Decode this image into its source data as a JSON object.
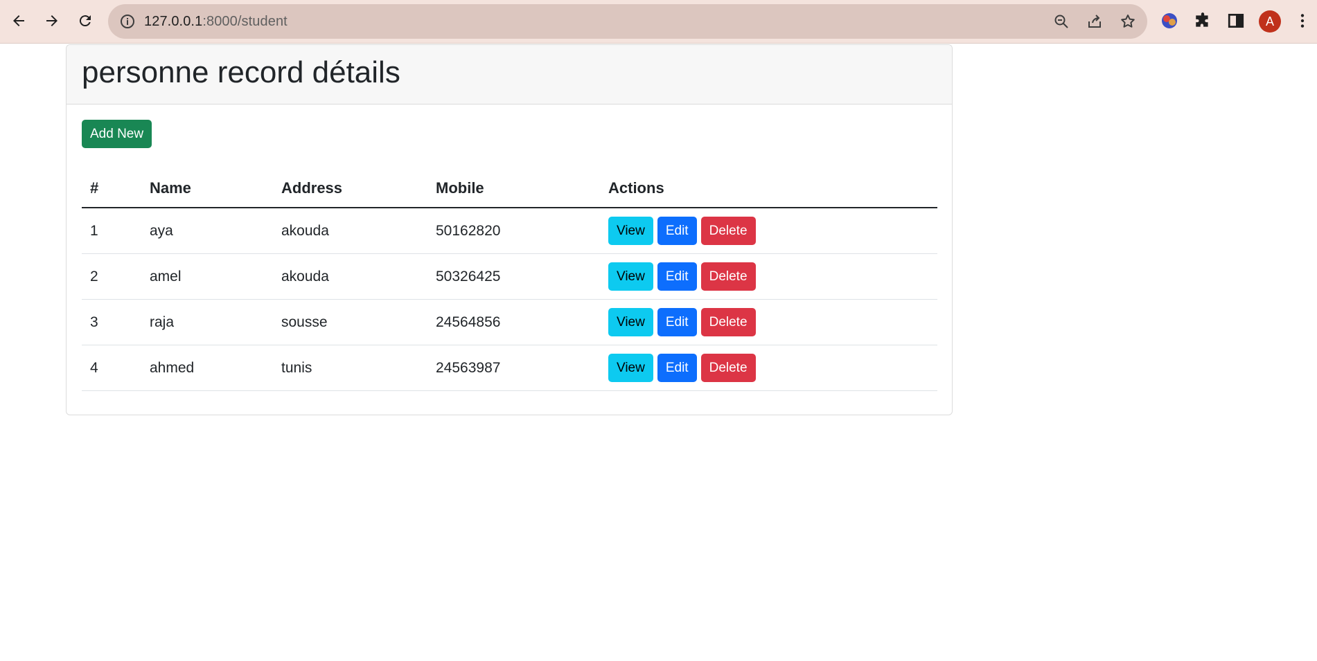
{
  "browser": {
    "url_host": "127.0.0.1",
    "url_path": ":8000/student",
    "profile_initial": "A",
    "icons": [
      "back-arrow-icon",
      "forward-arrow-icon",
      "reload-icon",
      "info-icon",
      "zoom-out-icon",
      "share-icon",
      "star-icon",
      "extension-app-icon",
      "puzzle-icon",
      "side-panel-icon",
      "kebab-menu-icon"
    ]
  },
  "page": {
    "title": "personne record détails",
    "add_button": "Add New"
  },
  "table": {
    "headers": [
      "#",
      "Name",
      "Address",
      "Mobile",
      "Actions"
    ],
    "rows": [
      {
        "num": "1",
        "name": "aya",
        "address": "akouda",
        "mobile": "50162820"
      },
      {
        "num": "2",
        "name": "amel",
        "address": "akouda",
        "mobile": "50326425"
      },
      {
        "num": "3",
        "name": "raja",
        "address": "sousse",
        "mobile": "24564856"
      },
      {
        "num": "4",
        "name": "ahmed",
        "address": "tunis",
        "mobile": "24563987"
      }
    ],
    "actions": {
      "view": "View",
      "edit": "Edit",
      "delete": "Delete"
    }
  },
  "colors": {
    "success": "#198754",
    "info": "#0dcaf0",
    "primary": "#0d6efd",
    "danger": "#dc3545",
    "browser_bar": "#f4e3dd",
    "avatar": "#c0311b"
  }
}
